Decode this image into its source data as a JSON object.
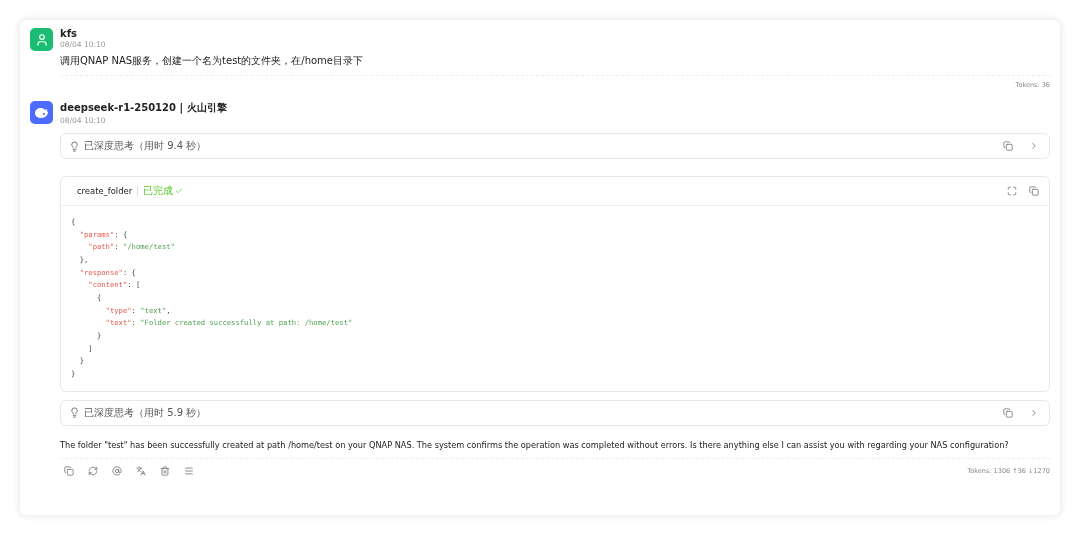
{
  "messages": [
    {
      "kind": "user",
      "author": "kfs",
      "time": "08/04 10:10",
      "text": "调用QNAP NAS服务，创建一个名为test的文件夹，在/home目录下",
      "tokens": "Tokens: 36"
    },
    {
      "kind": "assistant",
      "author": "deepseek-r1-250120 | 火山引擎",
      "time": "08/04 10:10",
      "blocks": [
        {
          "kind": "thinking",
          "label": "已深度思考（用时 9.4 秒）"
        },
        {
          "kind": "tool",
          "name": "create_folder",
          "status": "已完成",
          "lines": [
            [
              {
                "kind": "p",
                "s": "{"
              }
            ],
            [
              {
                "kind": "k",
                "s": "  \"params\""
              },
              {
                "kind": "p",
                "s": ": {"
              }
            ],
            [
              {
                "kind": "k",
                "s": "    \"path\""
              },
              {
                "kind": "p",
                "s": ": "
              },
              {
                "kind": "v",
                "s": "\"/home/test\""
              }
            ],
            [
              {
                "kind": "p",
                "s": "  },"
              }
            ],
            [
              {
                "kind": "k",
                "s": "  \"response\""
              },
              {
                "kind": "p",
                "s": ": {"
              }
            ],
            [
              {
                "kind": "k",
                "s": "    \"content\""
              },
              {
                "kind": "p",
                "s": ": ["
              }
            ],
            [
              {
                "kind": "p",
                "s": "      {"
              }
            ],
            [
              {
                "kind": "k",
                "s": "        \"type\""
              },
              {
                "kind": "p",
                "s": ": "
              },
              {
                "kind": "v",
                "s": "\"text\""
              },
              {
                "kind": "p",
                "s": ","
              }
            ],
            [
              {
                "kind": "k",
                "s": "        \"text\""
              },
              {
                "kind": "p",
                "s": ": "
              },
              {
                "kind": "v",
                "s": "\"Folder created successfully at path: /home/test\""
              }
            ],
            [
              {
                "kind": "p",
                "s": "      }"
              }
            ],
            [
              {
                "kind": "p",
                "s": "    ]"
              }
            ],
            [
              {
                "kind": "p",
                "s": "  }"
              }
            ],
            [
              {
                "kind": "p",
                "s": "}"
              }
            ]
          ]
        },
        {
          "kind": "thinking",
          "label": "已深度思考（用时 5.9 秒）"
        },
        {
          "kind": "text",
          "text": "The folder \"test\" has been successfully created at path /home/test on your QNAP NAS. The system confirms the operation was completed without errors. Is there anything else I can assist you with regarding your NAS configuration?"
        }
      ],
      "tokens": "Tokens: 1306 ↑36 ↓1270"
    }
  ]
}
